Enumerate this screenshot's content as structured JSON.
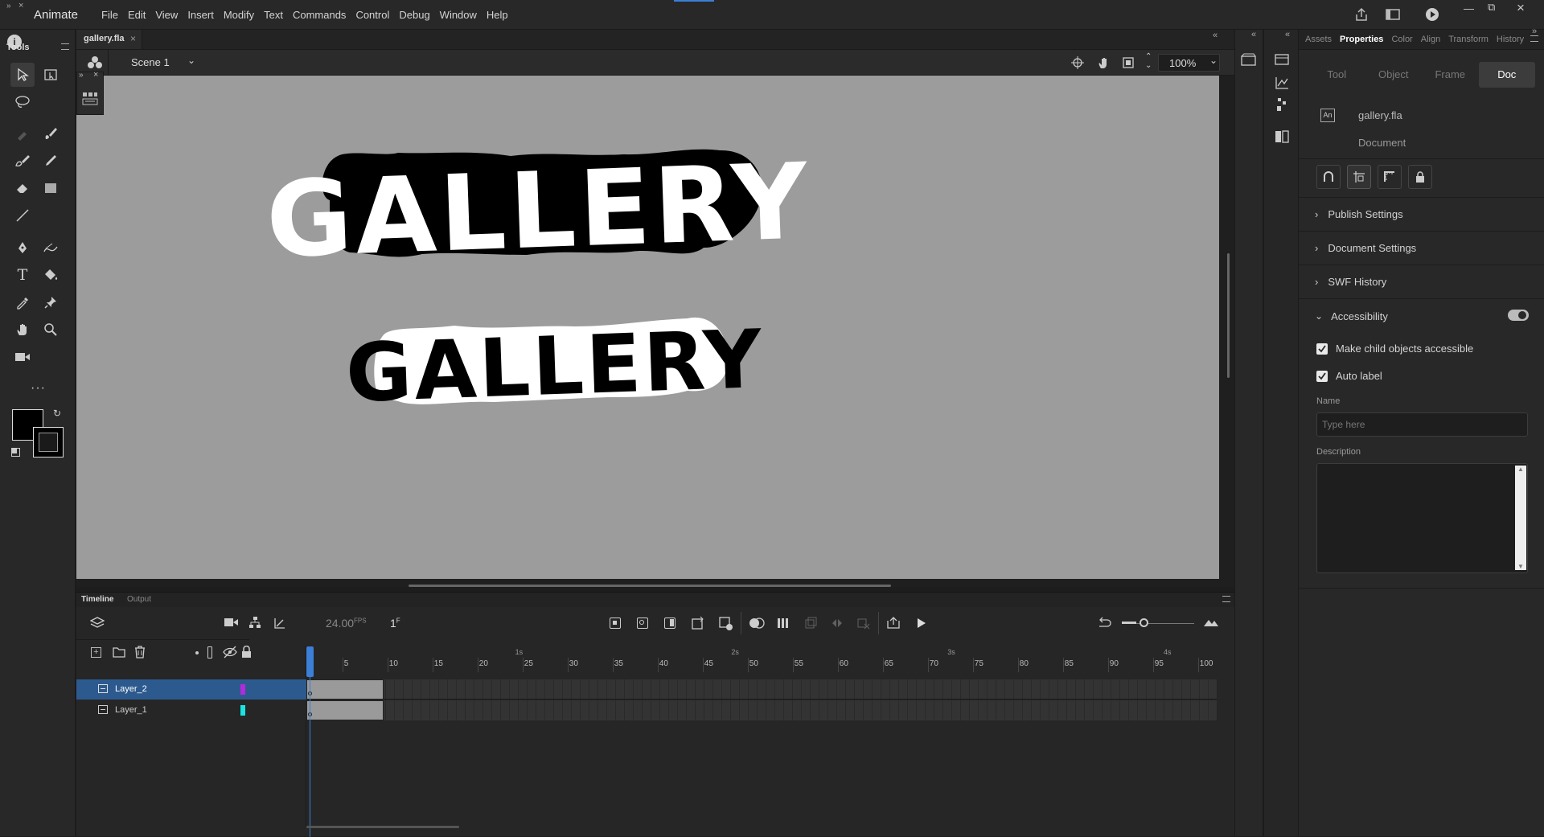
{
  "app": {
    "name": "Animate",
    "menus": [
      "File",
      "Edit",
      "View",
      "Insert",
      "Modify",
      "Text",
      "Commands",
      "Control",
      "Debug",
      "Window",
      "Help"
    ]
  },
  "tools": {
    "label": "Tools"
  },
  "document": {
    "tab": "gallery.fla",
    "scene": "Scene 1",
    "zoom": "100%"
  },
  "stage": {
    "text_top": "GALLERY",
    "text_bottom": "GALLERY",
    "background": "#9c9c9c"
  },
  "timeline": {
    "tabs": [
      "Timeline",
      "Output"
    ],
    "fps": "24.00",
    "fps_unit": "FPS",
    "frame": "1",
    "frame_unit": "F",
    "seconds": [
      "1s",
      "2s",
      "3s",
      "4s"
    ],
    "ruler": [
      "5",
      "10",
      "15",
      "20",
      "25",
      "30",
      "35",
      "40",
      "45",
      "50",
      "55",
      "60",
      "65",
      "70",
      "75",
      "80",
      "85",
      "90",
      "95",
      "100"
    ],
    "layers": [
      {
        "name": "Layer_2",
        "color": "#b12bdc",
        "selected": true
      },
      {
        "name": "Layer_1",
        "color": "#18e4e4",
        "selected": false
      }
    ]
  },
  "panel": {
    "tabs": [
      "Assets",
      "Properties",
      "Color",
      "Align",
      "Transform",
      "History"
    ],
    "active_tab": "Properties",
    "subtabs": [
      "Tool",
      "Object",
      "Frame",
      "Doc"
    ],
    "active_subtab": "Doc",
    "doc_name": "gallery.fla",
    "doc_type": "Document",
    "doc_icon_text": "An",
    "sections": [
      "Publish Settings",
      "Document Settings",
      "SWF History",
      "Accessibility"
    ],
    "checks": [
      "Make child objects accessible",
      "Auto label"
    ],
    "name_label": "Name",
    "name_placeholder": "Type here",
    "description_label": "Description"
  },
  "colors": {
    "accent": "#3b7fd6",
    "selected_row": "#2d5a8e"
  }
}
